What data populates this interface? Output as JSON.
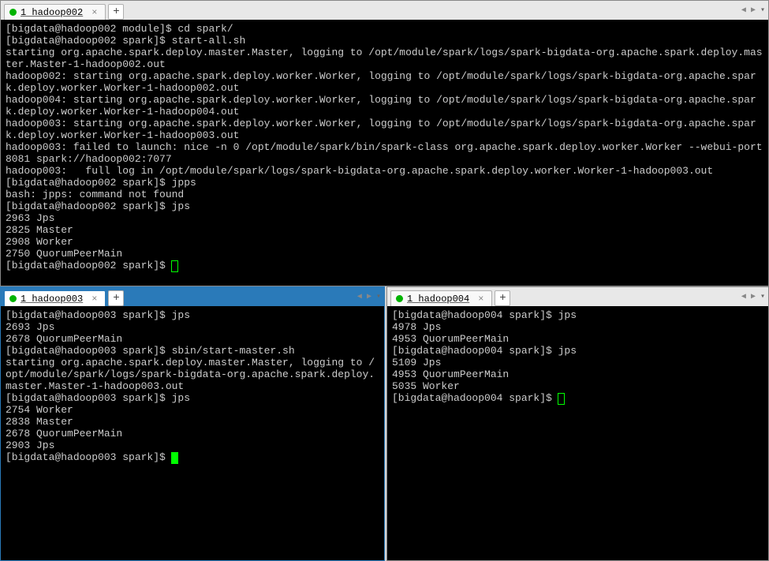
{
  "panes": {
    "top": {
      "active": false,
      "tab_label": "1 hadoop002",
      "lines": [
        "[bigdata@hadoop002 module]$ cd spark/",
        "[bigdata@hadoop002 spark]$ start-all.sh",
        "starting org.apache.spark.deploy.master.Master, logging to /opt/module/spark/logs/spark-bigdata-org.apache.spark.deploy.master.Master-1-hadoop002.out",
        "hadoop002: starting org.apache.spark.deploy.worker.Worker, logging to /opt/module/spark/logs/spark-bigdata-org.apache.spark.deploy.worker.Worker-1-hadoop002.out",
        "hadoop004: starting org.apache.spark.deploy.worker.Worker, logging to /opt/module/spark/logs/spark-bigdata-org.apache.spark.deploy.worker.Worker-1-hadoop004.out",
        "hadoop003: starting org.apache.spark.deploy.worker.Worker, logging to /opt/module/spark/logs/spark-bigdata-org.apache.spark.deploy.worker.Worker-1-hadoop003.out",
        "hadoop003: failed to launch: nice -n 0 /opt/module/spark/bin/spark-class org.apache.spark.deploy.worker.Worker --webui-port 8081 spark://hadoop002:7077",
        "hadoop003:   full log in /opt/module/spark/logs/spark-bigdata-org.apache.spark.deploy.worker.Worker-1-hadoop003.out",
        "[bigdata@hadoop002 spark]$ jpps",
        "bash: jpps: command not found",
        "[bigdata@hadoop002 spark]$ jps",
        "2963 Jps",
        "2825 Master",
        "2908 Worker",
        "2750 QuorumPeerMain",
        "[bigdata@hadoop002 spark]$ "
      ]
    },
    "left": {
      "active": true,
      "tab_label": "1 hadoop003",
      "lines": [
        "[bigdata@hadoop003 spark]$ jps",
        "2693 Jps",
        "2678 QuorumPeerMain",
        "[bigdata@hadoop003 spark]$ sbin/start-master.sh",
        "starting org.apache.spark.deploy.master.Master, logging to /opt/module/spark/logs/spark-bigdata-org.apache.spark.deploy.master.Master-1-hadoop003.out",
        "[bigdata@hadoop003 spark]$ jps",
        "2754 Worker",
        "2838 Master",
        "2678 QuorumPeerMain",
        "2903 Jps",
        "[bigdata@hadoop003 spark]$ "
      ]
    },
    "right": {
      "active": false,
      "tab_label": "1 hadoop004",
      "lines": [
        "[bigdata@hadoop004 spark]$ jps",
        "4978 Jps",
        "4953 QuorumPeerMain",
        "[bigdata@hadoop004 spark]$ jps",
        "5109 Jps",
        "4953 QuorumPeerMain",
        "5035 Worker",
        "[bigdata@hadoop004 spark]$ "
      ]
    }
  },
  "glyphs": {
    "close": "×",
    "plus": "+",
    "tri_left": "◀",
    "tri_right": "▶",
    "dropdown": "▾"
  }
}
